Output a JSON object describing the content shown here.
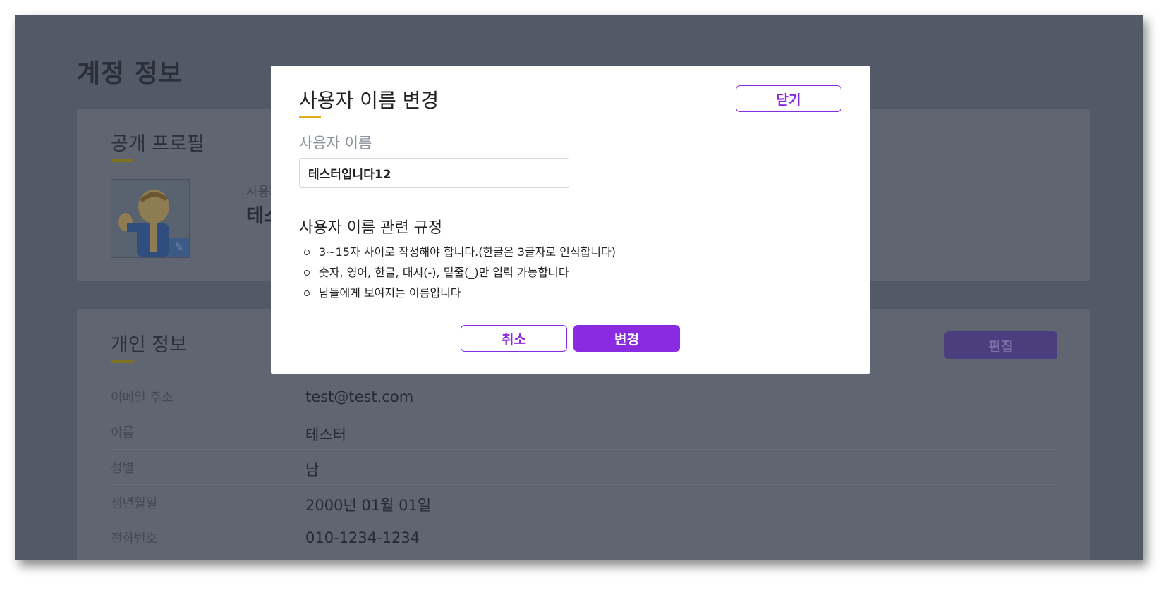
{
  "page": {
    "title": "계정 정보"
  },
  "profile_card": {
    "title": "공개 프로필",
    "username_label": "사용자",
    "username_value": "테스",
    "edit_icon": "pencil-icon"
  },
  "personal_card": {
    "title": "개인 정보",
    "edit_label": "편집",
    "rows": [
      {
        "label": "이메일 주소",
        "value": "test@test.com"
      },
      {
        "label": "이름",
        "value": "테스터"
      },
      {
        "label": "성별",
        "value": "남"
      },
      {
        "label": "생년월일",
        "value": "2000년 01월 01일"
      },
      {
        "label": "전화번호",
        "value": "010-1234-1234"
      }
    ]
  },
  "modal": {
    "title": "사용자 이름 변경",
    "close_label": "닫기",
    "field_label": "사용자 이름",
    "input_value": "테스터입니다12",
    "rules_title": "사용자 이름 관련 규정",
    "rules": [
      "3~15자 사이로 작성해야 합니다.(한글은 3글자로 인식합니다)",
      "숫자, 영어, 한글, 대시(-), 밑줄(_)만 입력 가능합니다",
      "남들에게 보여지는 이름입니다"
    ],
    "cancel_label": "취소",
    "submit_label": "변경"
  },
  "colors": {
    "accent": "#8a2be2",
    "title_underline": "#e2ad1e",
    "backdrop": "#525a67"
  }
}
